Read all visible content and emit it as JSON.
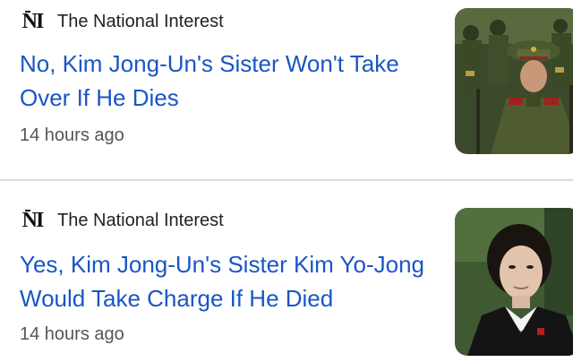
{
  "articles": [
    {
      "source": "The National Interest",
      "source_logo": "NI",
      "headline": "No, Kim Jong-Un's Sister Won't Take Over If He Dies",
      "time": "14 hours ago",
      "thumbnail": "military-parade-photo"
    },
    {
      "source": "The National Interest",
      "source_logo": "NI",
      "headline": "Yes, Kim Jong-Un's Sister Kim Yo-Jong Would Take Charge If He Died",
      "time": "14 hours ago",
      "thumbnail": "portrait-photo"
    }
  ],
  "colors": {
    "headline": "#1a56c4",
    "source": "#222222",
    "timestamp": "#555555",
    "divider": "#dcdcdc"
  }
}
